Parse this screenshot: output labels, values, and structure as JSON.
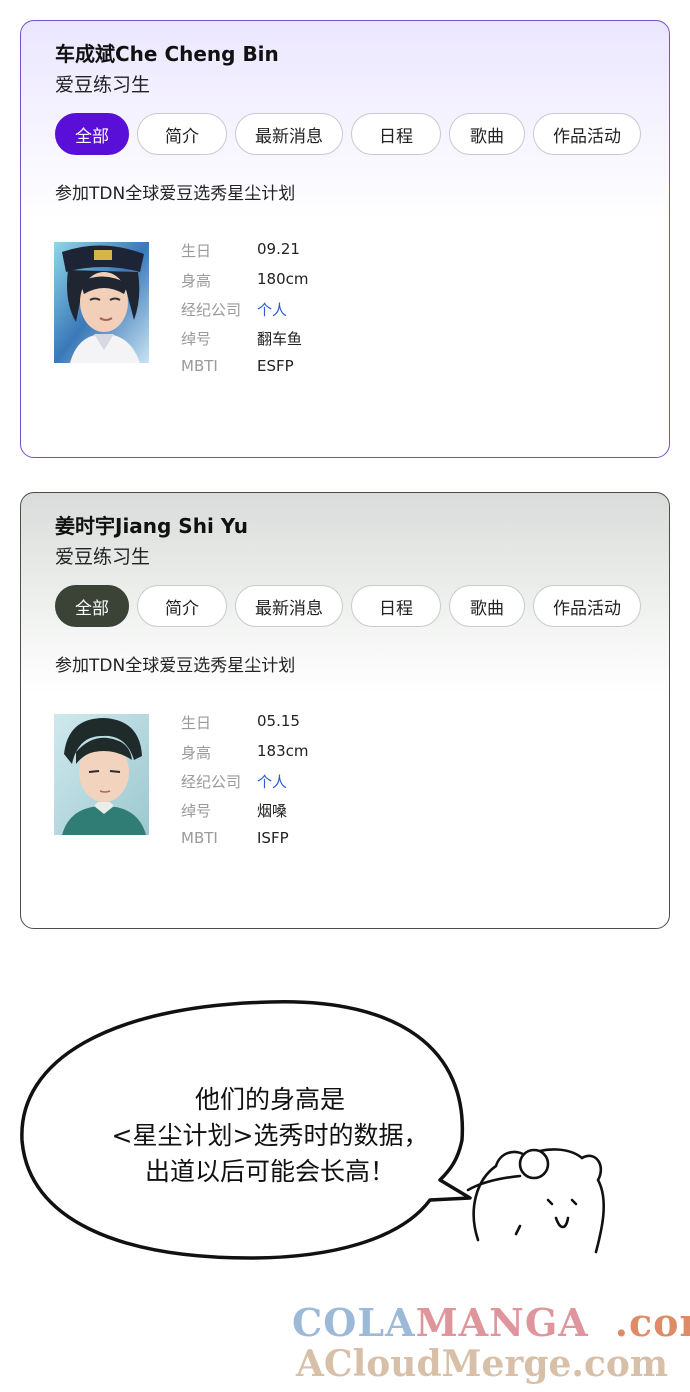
{
  "cards": [
    {
      "name": "车成斌Che Cheng Bin",
      "role": "爱豆练习生",
      "tabs": [
        "全部",
        "简介",
        "最新消息",
        "日程",
        "歌曲",
        "作品活动"
      ],
      "description": "参加TDN全球爱豆选秀星尘计划",
      "labels": [
        "生日",
        "身高",
        "经纪公司",
        "绰号",
        "MBTI"
      ],
      "values": [
        "09.21",
        "180cm",
        "个人",
        "翻车鱼",
        "ESFP"
      ],
      "accent": "#5a0fd8"
    },
    {
      "name": "姜时宇Jiang Shi Yu",
      "role": "爱豆练习生",
      "tabs": [
        "全部",
        "简介",
        "最新消息",
        "日程",
        "歌曲",
        "作品活动"
      ],
      "description": "参加TDN全球爱豆选秀星尘计划",
      "labels": [
        "生日",
        "身高",
        "经纪公司",
        "绰号",
        "MBTI"
      ],
      "values": [
        "05.15",
        "183cm",
        "个人",
        "烟嗓",
        "ISFP"
      ],
      "accent": "#3b4236"
    }
  ],
  "speech_bubble": {
    "lines": [
      "他们的身高是",
      "<星尘计划>选秀时的数据，",
      "出道以后可能会长高！"
    ]
  },
  "watermark": {
    "line1_a": "COLA",
    "line1_b": "MANGA",
    "line1_c": ".com",
    "line2": "ACloudMerge.com"
  }
}
